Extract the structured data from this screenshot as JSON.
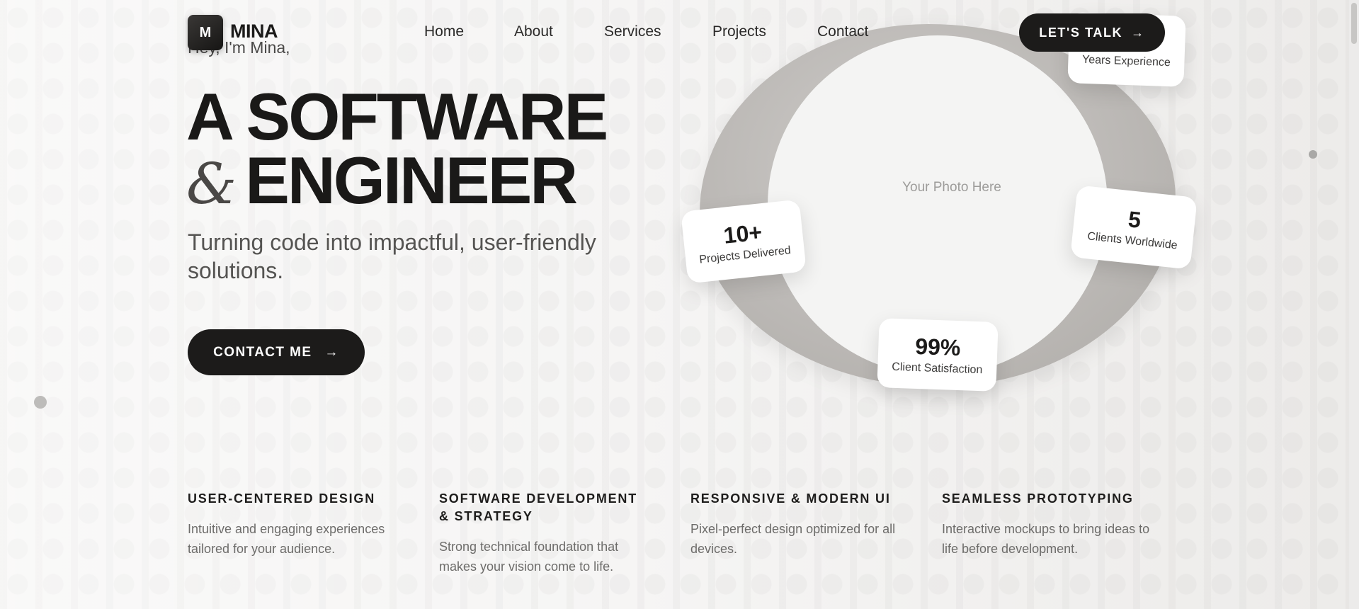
{
  "nav": {
    "logo_letter": "M",
    "logo_text": "MINA",
    "links": [
      "Home",
      "About",
      "Services",
      "Projects",
      "Contact"
    ],
    "cta_label": "LET'S TALK",
    "cta_arrow": "→"
  },
  "hero": {
    "greeting": "Hey, I'm Mina,",
    "headline_line1": "A SOFTWARE",
    "headline_amp": "&",
    "headline_line2": "ENGINEER",
    "subline": "Turning code into impactful, user-friendly solutions.",
    "contact_label": "CONTACT ME",
    "contact_arrow": "→"
  },
  "photo": {
    "placeholder": "Your Photo Here"
  },
  "stats": [
    {
      "value": "",
      "label": "Years Experience"
    },
    {
      "value": "10+",
      "label": "Projects Delivered"
    },
    {
      "value": "5",
      "label": "Clients Worldwide"
    },
    {
      "value": "99%",
      "label": "Client Satisfaction"
    }
  ],
  "services": [
    {
      "title": "USER-CENTERED DESIGN",
      "desc": "Intuitive and engaging experiences tailored for your audience."
    },
    {
      "title": "SOFTWARE DEVELOPMENT & STRATEGY",
      "desc": "Strong technical foundation that makes your vision come to life."
    },
    {
      "title": "RESPONSIVE & MODERN UI",
      "desc": "Pixel-perfect design optimized for all devices."
    },
    {
      "title": "SEAMLESS PROTOTYPING",
      "desc": "Interactive mockups to bring ideas to life before development."
    }
  ],
  "colors": {
    "accent": "#1c1b1a",
    "background": "#f3f2f1",
    "ring": "#bcb9b6"
  }
}
